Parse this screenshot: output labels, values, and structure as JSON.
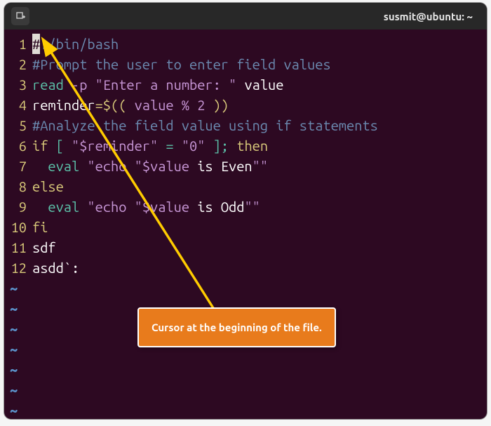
{
  "titlebar": {
    "title": "susmit@ubuntu: ~"
  },
  "editor": {
    "lines": [
      "#!/bin/bash",
      "#Prompt the user to enter field values",
      "read -p \"Enter a number: \" value",
      "reminder=$(( value % 2 ))",
      "#Analyze the field value using if statements",
      "if [ \"$reminder\" = \"0\" ]; then",
      "  eval \"echo \"$value is Even\"\"",
      "else",
      "  eval \"echo \"$value is Odd\"\"",
      "fi",
      "sdf",
      "asdd`:"
    ],
    "line_numbers": [
      "1",
      "2",
      "3",
      "4",
      "5",
      "6",
      "7",
      "8",
      "9",
      "10",
      "11",
      "12"
    ],
    "cursor_line": 1,
    "cursor_col": 0,
    "cursor_char": "#",
    "empty_tilde_rows": 7
  },
  "annotation": {
    "label": "Cursor at the beginning of the file."
  },
  "colors": {
    "window_bg": "#2d0922",
    "titlebar_bg": "#282828",
    "keyword": "#d9c97a",
    "command": "#5bc0a8",
    "string": "#c796d6",
    "comment": "#6b8ab0",
    "annotation_bg": "#e87b1c",
    "tilde": "#5a90c8"
  }
}
